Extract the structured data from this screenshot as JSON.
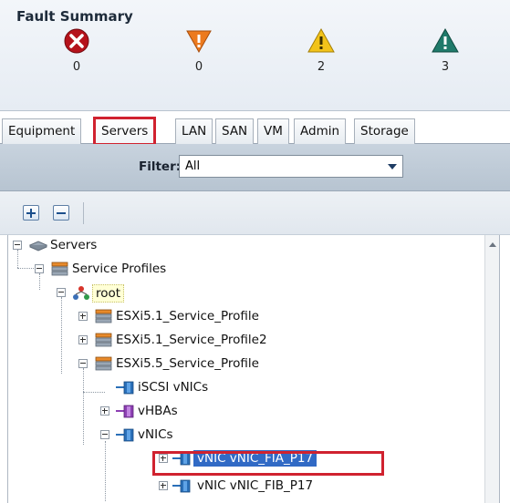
{
  "fault_summary": {
    "title": "Fault Summary",
    "items": [
      {
        "severity": "critical",
        "count": "0",
        "color": "#b5121b",
        "icon": "critical-x-icon"
      },
      {
        "severity": "major",
        "count": "0",
        "color": "#e8731b",
        "icon": "major-down-triangle-icon"
      },
      {
        "severity": "minor",
        "count": "2",
        "color": "#f0c419",
        "icon": "minor-warning-icon"
      },
      {
        "severity": "warning",
        "count": "3",
        "color": "#1f7a6a",
        "icon": "warning-triangle-icon"
      }
    ]
  },
  "tabs": [
    {
      "label": "Equipment",
      "active": false
    },
    {
      "label": "Servers",
      "active": true
    },
    {
      "label": "LAN",
      "active": false
    },
    {
      "label": "SAN",
      "active": false
    },
    {
      "label": "VM",
      "active": false
    },
    {
      "label": "Admin",
      "active": false
    },
    {
      "label": "Storage",
      "active": false
    }
  ],
  "filter": {
    "label": "Filter:",
    "value": "All"
  },
  "toolbar": {
    "expand_icon": "plus-icon",
    "collapse_icon": "minus-icon"
  },
  "tree": {
    "nodes": [
      {
        "label": "Servers",
        "icon": "servers-icon"
      },
      {
        "label": "Service Profiles",
        "icon": "service-profiles-icon"
      },
      {
        "label": "root",
        "icon": "org-root-icon"
      },
      {
        "label": "ESXi5.1_Service_Profile",
        "icon": "service-profile-icon"
      },
      {
        "label": "ESXi5.1_Service_Profile2",
        "icon": "service-profile-icon"
      },
      {
        "label": "ESXi5.5_Service_Profile",
        "icon": "service-profile-icon"
      },
      {
        "label": "iSCSI vNICs",
        "icon": "iscsi-vnic-icon"
      },
      {
        "label": "vHBAs",
        "icon": "vhba-icon"
      },
      {
        "label": "vNICs",
        "icon": "vnic-icon"
      },
      {
        "label": "vNIC vNIC_FIA_P17",
        "icon": "vnic-icon",
        "selected": true
      },
      {
        "label": "vNIC vNIC_FIB_P17",
        "icon": "vnic-icon"
      }
    ]
  },
  "colors": {
    "accent_highlight": "#d0222f",
    "selection": "#316ac5"
  }
}
